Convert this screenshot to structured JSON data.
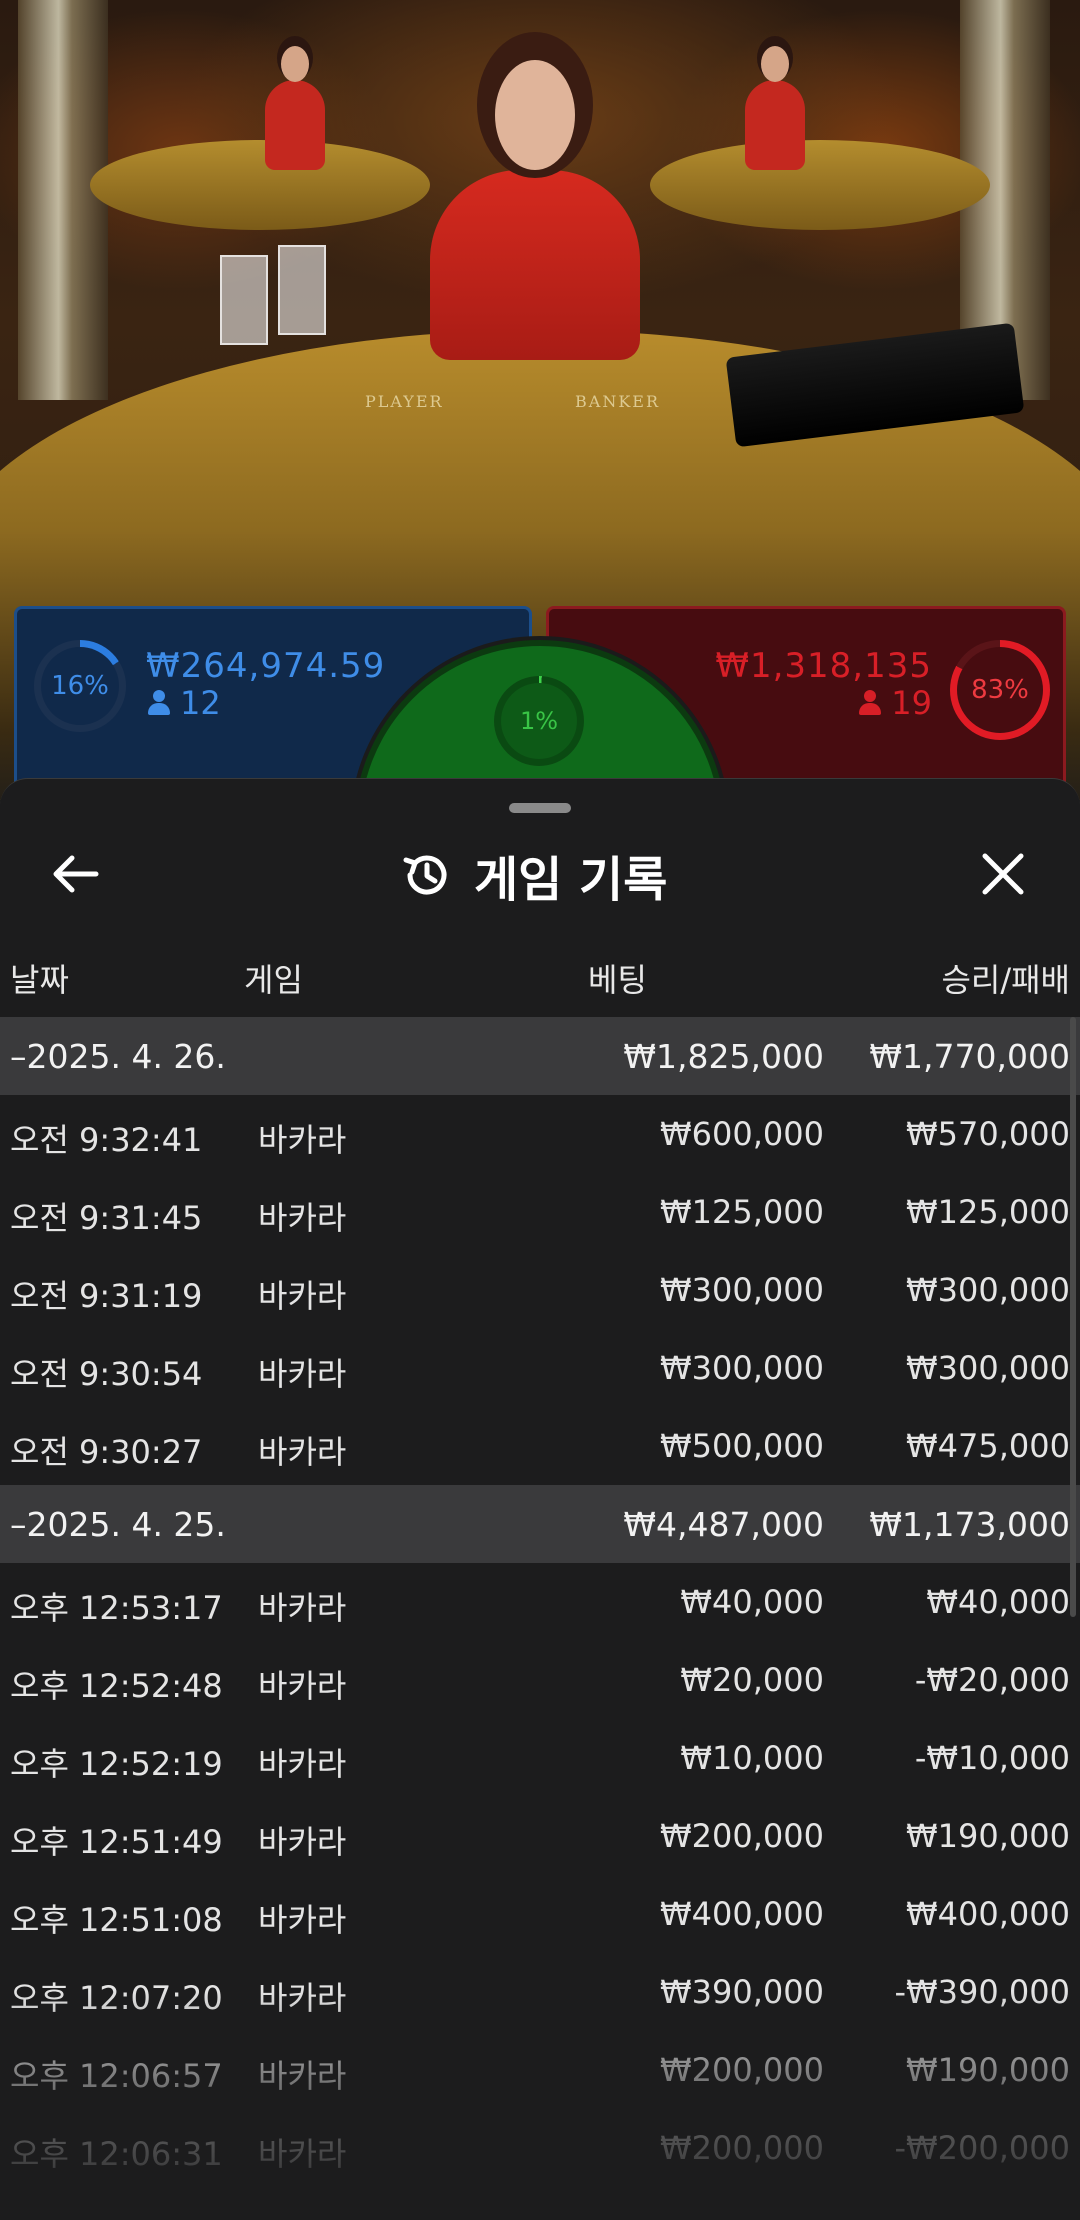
{
  "video": {
    "table_labels": [
      "PLAYER",
      "BANKER"
    ]
  },
  "bet_stats": {
    "player": {
      "percent": "16%",
      "amount": "₩264,974.59",
      "players": "12",
      "color": "#2c7de0"
    },
    "tie": {
      "percent": "1%",
      "color": "#3ed44b"
    },
    "banker": {
      "percent": "83%",
      "amount": "₩1,318,135",
      "players": "19",
      "color": "#e11b25"
    }
  },
  "sheet": {
    "title": "게임 기록",
    "icons": {
      "back": "arrow-left-icon",
      "history": "history-icon",
      "close": "close-icon"
    },
    "columns": {
      "date": "날짜",
      "game": "게임",
      "bet": "베팅",
      "result": "승리/패배"
    },
    "rows": [
      {
        "type": "date",
        "time": "–2025. 4. 26.",
        "game": "",
        "bet": "₩1,825,000",
        "result": "₩1,770,000"
      },
      {
        "type": "entry",
        "time": "오전 9:32:41",
        "game": "바카라",
        "bet": "₩600,000",
        "result": "₩570,000"
      },
      {
        "type": "entry",
        "time": "오전 9:31:45",
        "game": "바카라",
        "bet": "₩125,000",
        "result": "₩125,000"
      },
      {
        "type": "entry",
        "time": "오전 9:31:19",
        "game": "바카라",
        "bet": "₩300,000",
        "result": "₩300,000"
      },
      {
        "type": "entry",
        "time": "오전 9:30:54",
        "game": "바카라",
        "bet": "₩300,000",
        "result": "₩300,000"
      },
      {
        "type": "entry",
        "time": "오전 9:30:27",
        "game": "바카라",
        "bet": "₩500,000",
        "result": "₩475,000"
      },
      {
        "type": "date",
        "time": "–2025. 4. 25.",
        "game": "",
        "bet": "₩4,487,000",
        "result": "₩1,173,000"
      },
      {
        "type": "entry",
        "time": "오후 12:53:17",
        "game": "바카라",
        "bet": "₩40,000",
        "result": "₩40,000"
      },
      {
        "type": "entry",
        "time": "오후 12:52:48",
        "game": "바카라",
        "bet": "₩20,000",
        "result": "-₩20,000"
      },
      {
        "type": "entry",
        "time": "오후 12:52:19",
        "game": "바카라",
        "bet": "₩10,000",
        "result": "-₩10,000"
      },
      {
        "type": "entry",
        "time": "오후 12:51:49",
        "game": "바카라",
        "bet": "₩200,000",
        "result": "₩190,000"
      },
      {
        "type": "entry",
        "time": "오후 12:51:08",
        "game": "바카라",
        "bet": "₩400,000",
        "result": "₩400,000"
      },
      {
        "type": "entry",
        "time": "오후 12:07:20",
        "game": "바카라",
        "bet": "₩390,000",
        "result": "-₩390,000"
      },
      {
        "type": "entry",
        "time": "오후 12:06:57",
        "game": "바카라",
        "bet": "₩200,000",
        "result": "₩190,000"
      },
      {
        "type": "entry",
        "time": "오후 12:06:31",
        "game": "바카라",
        "bet": "₩200,000",
        "result": "-₩200,000"
      }
    ]
  }
}
